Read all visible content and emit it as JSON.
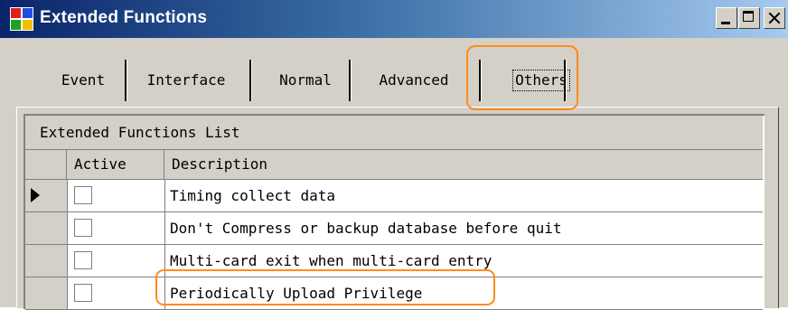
{
  "window": {
    "title": "Extended Functions",
    "controls": [
      "minimize",
      "maximize",
      "close"
    ]
  },
  "tabs": [
    {
      "label": "Event",
      "selected": false
    },
    {
      "label": "Interface",
      "selected": false
    },
    {
      "label": "Normal",
      "selected": false
    },
    {
      "label": "Advanced",
      "selected": false
    },
    {
      "label": "Others",
      "selected": true
    }
  ],
  "grid": {
    "caption": "Extended Functions List",
    "columns": [
      "Active",
      "Description"
    ],
    "rows": [
      {
        "active": false,
        "description": "Timing collect data",
        "current": true
      },
      {
        "active": false,
        "description": "Don't Compress or backup database before quit",
        "current": false
      },
      {
        "active": false,
        "description": "Multi-card exit when multi-card entry",
        "current": false
      },
      {
        "active": false,
        "description": "Periodically Upload Privilege",
        "current": false
      }
    ]
  },
  "colors": {
    "annotation_highlight": "#ff8c1a",
    "titlebar_start": "#0a246a",
    "titlebar_end": "#a6caf0"
  }
}
